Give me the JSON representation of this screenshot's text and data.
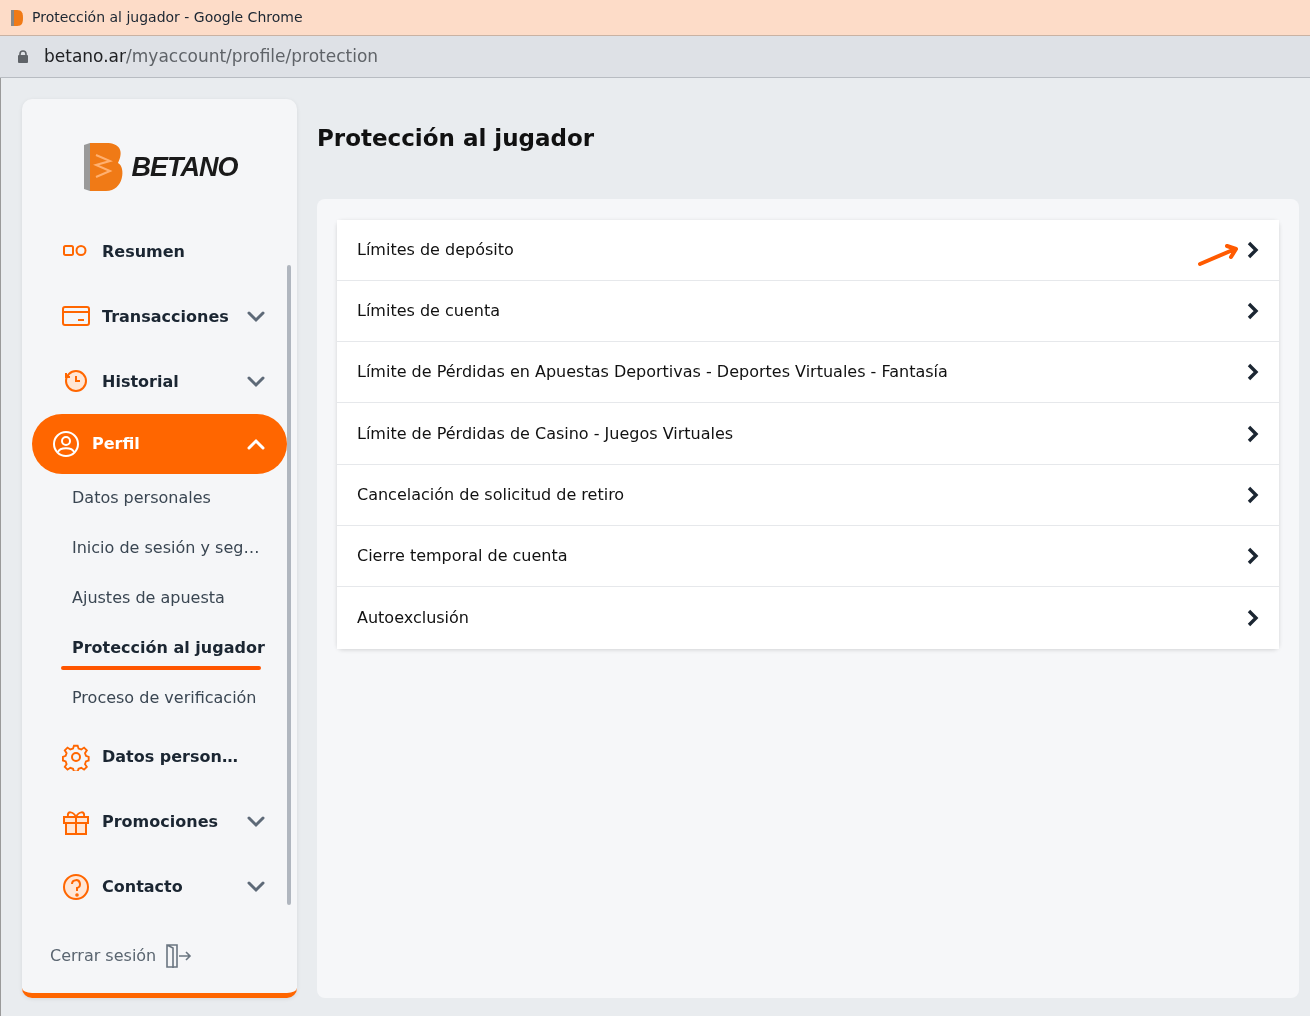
{
  "window": {
    "title": "Protección al jugador - Google Chrome"
  },
  "address_bar": {
    "domain": "betano.ar",
    "path": "/myaccount/profile/protection"
  },
  "sidebar": {
    "logo": "BETANO",
    "items": [
      {
        "label": "Resumen",
        "kind": "link",
        "selected": false
      },
      {
        "label": "Transacciones",
        "kind": "group",
        "expanded": false,
        "selected": false
      },
      {
        "label": "Historial",
        "kind": "group",
        "expanded": false,
        "selected": false
      },
      {
        "label": "Perfil",
        "kind": "group",
        "expanded": true,
        "selected": true,
        "children": [
          {
            "label": "Datos personales",
            "selected": false
          },
          {
            "label": "Inicio de sesión y seg…",
            "selected": false
          },
          {
            "label": "Ajustes de apuesta",
            "selected": false
          },
          {
            "label": "Protección al jugador",
            "selected": true
          },
          {
            "label": "Proceso de verificación",
            "selected": false
          }
        ]
      },
      {
        "label": "Datos person…",
        "kind": "link",
        "selected": false
      },
      {
        "label": "Promociones",
        "kind": "group",
        "expanded": false,
        "selected": false
      },
      {
        "label": "Contacto",
        "kind": "group",
        "expanded": false,
        "selected": false
      }
    ],
    "logout": "Cerrar sesión"
  },
  "main": {
    "title": "Protección al jugador",
    "options": [
      {
        "label": "Límites de depósito",
        "annotated": true
      },
      {
        "label": "Límites de cuenta",
        "annotated": false
      },
      {
        "label": "Límite de Pérdidas en Apuestas Deportivas - Deportes Virtuales - Fantasía",
        "annotated": false
      },
      {
        "label": "Límite de Pérdidas de Casino - Juegos Virtuales",
        "annotated": false
      },
      {
        "label": "Cancelación de solicitud de retiro",
        "annotated": false
      },
      {
        "label": "Cierre temporal de cuenta",
        "annotated": false
      },
      {
        "label": "Autoexclusión",
        "annotated": false
      }
    ]
  }
}
